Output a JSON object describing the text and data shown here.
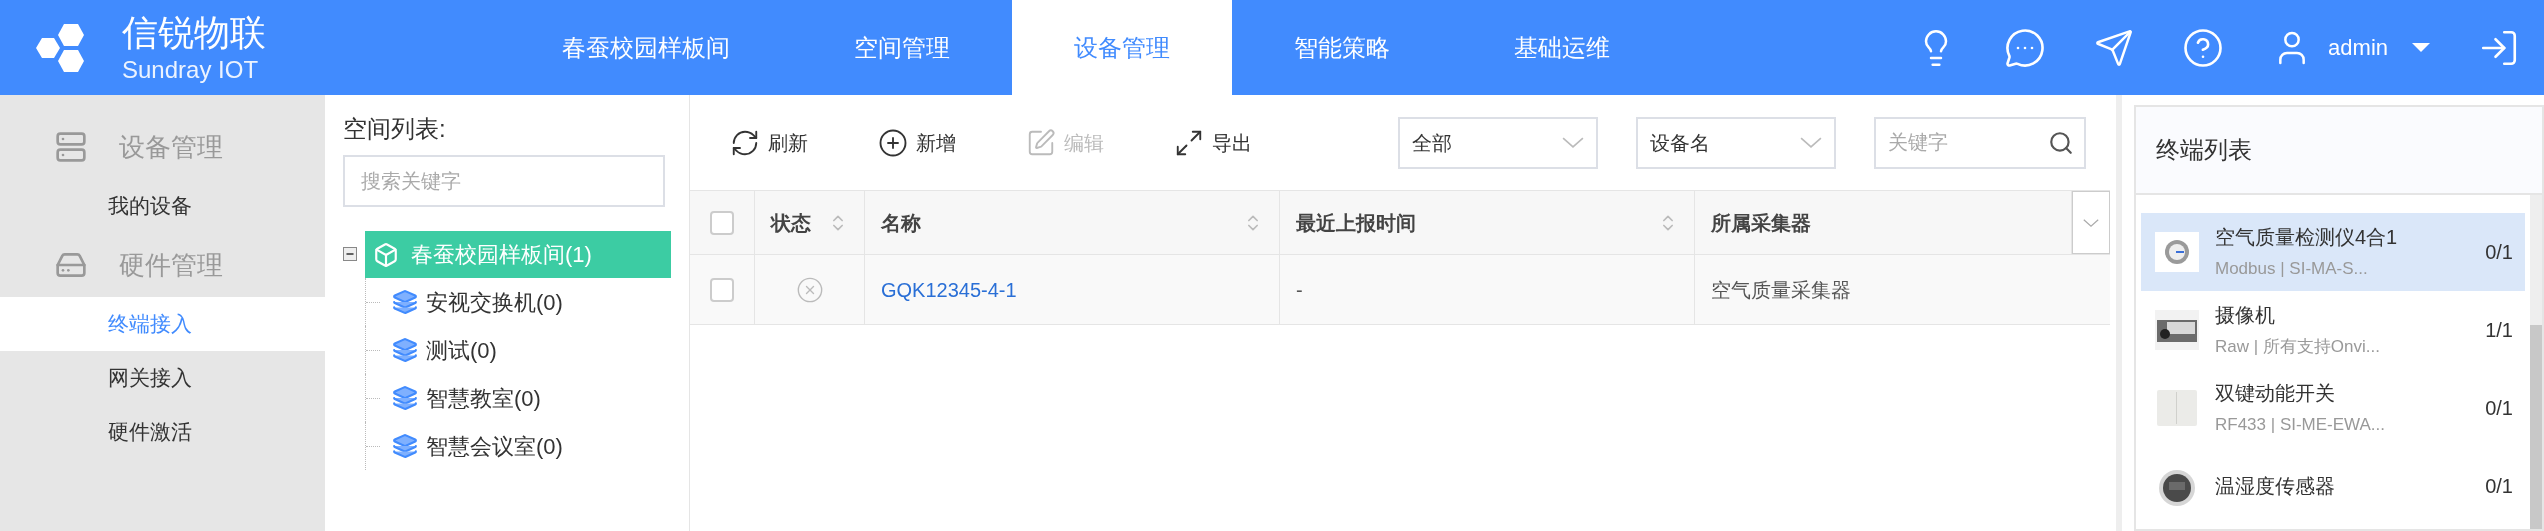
{
  "header": {
    "logo_name": "信锐物联",
    "logo_subtitle": "Sundray IOT",
    "nav": [
      {
        "label": "春蚕校园样板间",
        "selected": false
      },
      {
        "label": "空间管理",
        "selected": false
      },
      {
        "label": "设备管理",
        "selected": true
      },
      {
        "label": "智能策略",
        "selected": false
      },
      {
        "label": "基础运维",
        "selected": false
      }
    ],
    "user": "admin"
  },
  "sidebar": [
    {
      "label": "设备管理",
      "kind": "server",
      "items": [
        {
          "label": "我的设备",
          "selected": false
        }
      ]
    },
    {
      "label": "硬件管理",
      "kind": "drive",
      "items": [
        {
          "label": "终端接入",
          "selected": true
        },
        {
          "label": "网关接入",
          "selected": false
        },
        {
          "label": "硬件激活",
          "selected": false
        }
      ]
    }
  ],
  "space_tree": {
    "title": "空间列表:",
    "search_placeholder": "搜索关键字",
    "root": {
      "label": "春蚕校园样板间(1)",
      "selected": true,
      "expanded": true,
      "children": [
        {
          "label": "安视交换机(0)",
          "selected": false
        },
        {
          "label": "测试(0)",
          "selected": false
        },
        {
          "label": "智慧教室(0)",
          "selected": false
        },
        {
          "label": "智慧会议室(0)",
          "selected": false
        }
      ]
    }
  },
  "toolbar": {
    "buttons": [
      {
        "label": "刷新",
        "kind": "refresh",
        "disabled": false
      },
      {
        "label": "新增",
        "kind": "add",
        "disabled": false
      },
      {
        "label": "编辑",
        "kind": "edit",
        "disabled": true
      },
      {
        "label": "导出",
        "kind": "export",
        "disabled": false
      }
    ],
    "filters": [
      {
        "value": "全部"
      },
      {
        "value": "设备名"
      }
    ],
    "search_placeholder": "关键字"
  },
  "table": {
    "columns": [
      {
        "label": "状态",
        "sortable": true
      },
      {
        "label": "名称",
        "sortable": true
      },
      {
        "label": "最近上报时间",
        "sortable": true
      },
      {
        "label": "所属采集器",
        "sortable": false
      }
    ],
    "all_checked": false,
    "rows": [
      {
        "checked": false,
        "online": false,
        "name": "GQK12345-4-1",
        "last_report": "-",
        "collector": "空气质量采集器"
      }
    ]
  },
  "terminal_list": {
    "title": "终端列表",
    "items": [
      {
        "name": "空气质量检测仪4合1",
        "detail": "Modbus | SI-MA-S...",
        "count": "0/1",
        "selected": true
      },
      {
        "name": "摄像机",
        "detail": "Raw | 所有支持Onvi...",
        "count": "1/1",
        "selected": false
      },
      {
        "name": "双键动能开关",
        "detail": "RF433 | SI-ME-EWA...",
        "count": "0/1",
        "selected": false
      },
      {
        "name": "温湿度传感器",
        "count": "0/1",
        "selected": false
      }
    ]
  }
}
